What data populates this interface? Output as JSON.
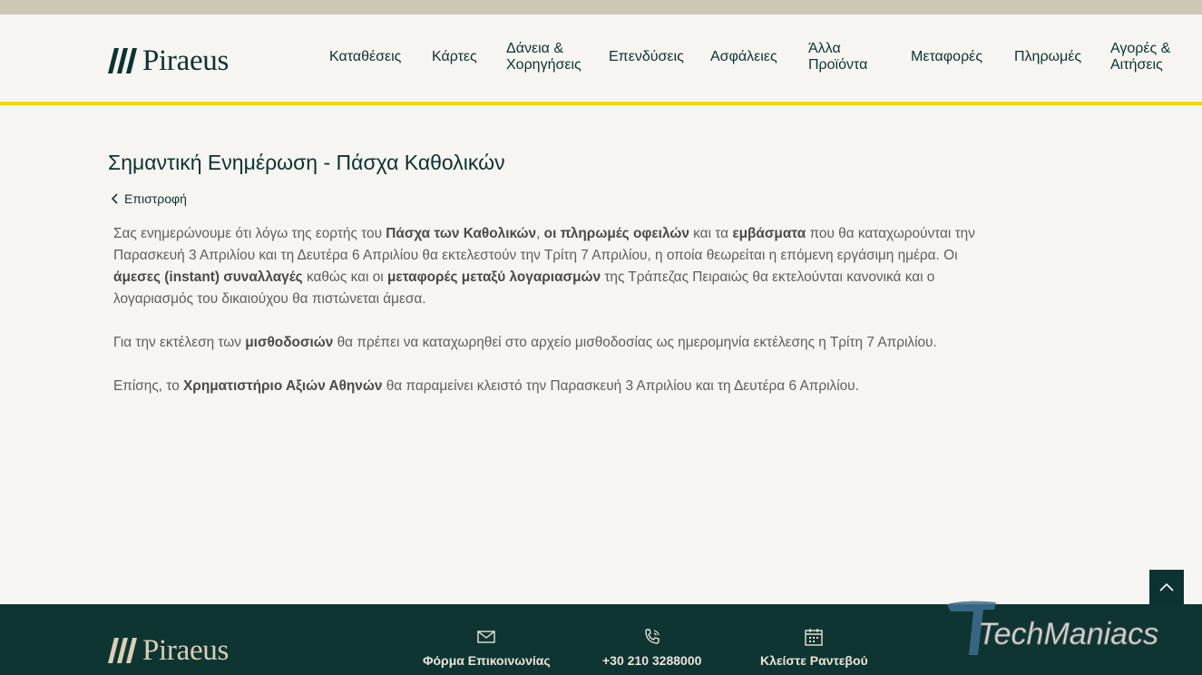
{
  "header": {
    "logo_text": "Piraeus",
    "nav": [
      {
        "line1": "Καταθέσεις",
        "line2": ""
      },
      {
        "line1": "Κάρτες",
        "line2": ""
      },
      {
        "line1": "Δάνεια &",
        "line2": "Χορηγήσεις"
      },
      {
        "line1": "Επενδύσεις",
        "line2": ""
      },
      {
        "line1": "Ασφάλειες",
        "line2": ""
      },
      {
        "line1": "Άλλα",
        "line2": "Προϊόντα"
      },
      {
        "line1": "Μεταφορές",
        "line2": ""
      },
      {
        "line1": "Πληρωμές",
        "line2": ""
      },
      {
        "line1": "Αγορές &",
        "line2": "Αιτήσεις"
      }
    ]
  },
  "page": {
    "title": "Σημαντική Ενημέρωση - Πάσχα Καθολικών",
    "back_label": "Επιστροφή",
    "p1": {
      "t1": "Σας ενημερώνουμε ότι λόγω της εορτής του ",
      "b1": "Πάσχα των Καθολικών",
      "t2": ", ",
      "b2": "οι πληρωμές οφειλών",
      "t3": " και τα ",
      "b3": "εμβάσματα",
      "t4": " που θα καταχωρούνται την Παρασκευή 3 Απριλίου και τη Δευτέρα 6 Απριλίου θα εκτελεστούν την Τρίτη 7 Απριλίου, η οποία θεωρείται η επόμενη εργάσιμη ημέρα. Οι ",
      "b4": "άμεσες (instant) συναλλαγές",
      "t5": " καθώς και οι ",
      "b5": "μεταφορές μεταξύ λογαριασμών",
      "t6": " της Τράπεζας Πειραιώς θα εκτελούνται κανονικά και ο λογαριασμός του δικαιούχου θα πιστώνεται άμεσα."
    },
    "p2": {
      "t1": "Για την εκτέλεση των ",
      "b1": "μισθοδοσιών",
      "t2": " θα πρέπει να καταχωρηθεί στο αρχείο μισθοδοσίας ως ημερομηνία εκτέλεσης η Τρίτη 7 Απριλίου."
    },
    "p3": {
      "t1": "Επίσης, το ",
      "b1": "Χρηματιστήριο Αξιών Αθηνών",
      "t2": " θα παραμείνει κλειστό την Παρασκευή 3 Απριλίου και τη Δευτέρα 6 Απριλίου."
    }
  },
  "footer": {
    "logo_text": "Piraeus",
    "contact_form": "Φόρμα Επικοινωνίας",
    "phone": "+30 210 3288000",
    "appointment": "Κλείστε Ραντεβού"
  },
  "watermark": {
    "text": "TechManiacs"
  },
  "colors": {
    "brand": "#0c3331",
    "accent": "#f3d60d",
    "footer_bg": "#0f3532",
    "page_bg": "#f7f5f1"
  }
}
